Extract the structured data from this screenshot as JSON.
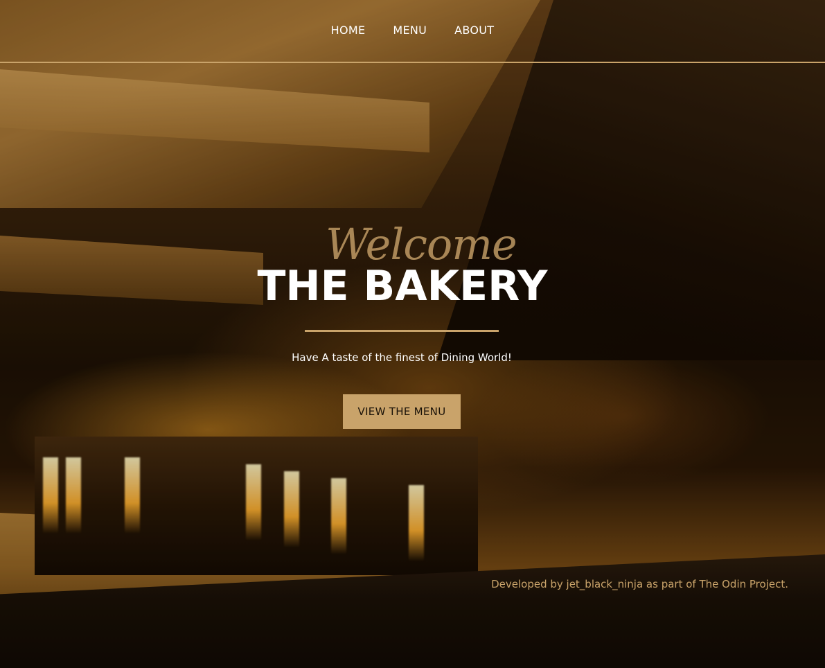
{
  "nav": {
    "items": [
      {
        "label": "HOME"
      },
      {
        "label": "MENU"
      },
      {
        "label": "ABOUT"
      }
    ]
  },
  "hero": {
    "welcome": "Welcome",
    "title": "THE BAKERY",
    "tagline": "Have A taste of the finest of Dining World!",
    "cta_label": "VIEW THE MENU"
  },
  "footer": {
    "credit": "Developed by jet_black_ninja as part of The Odin Project."
  },
  "colors": {
    "accent": "#c9a36a",
    "text": "#ffffff"
  }
}
